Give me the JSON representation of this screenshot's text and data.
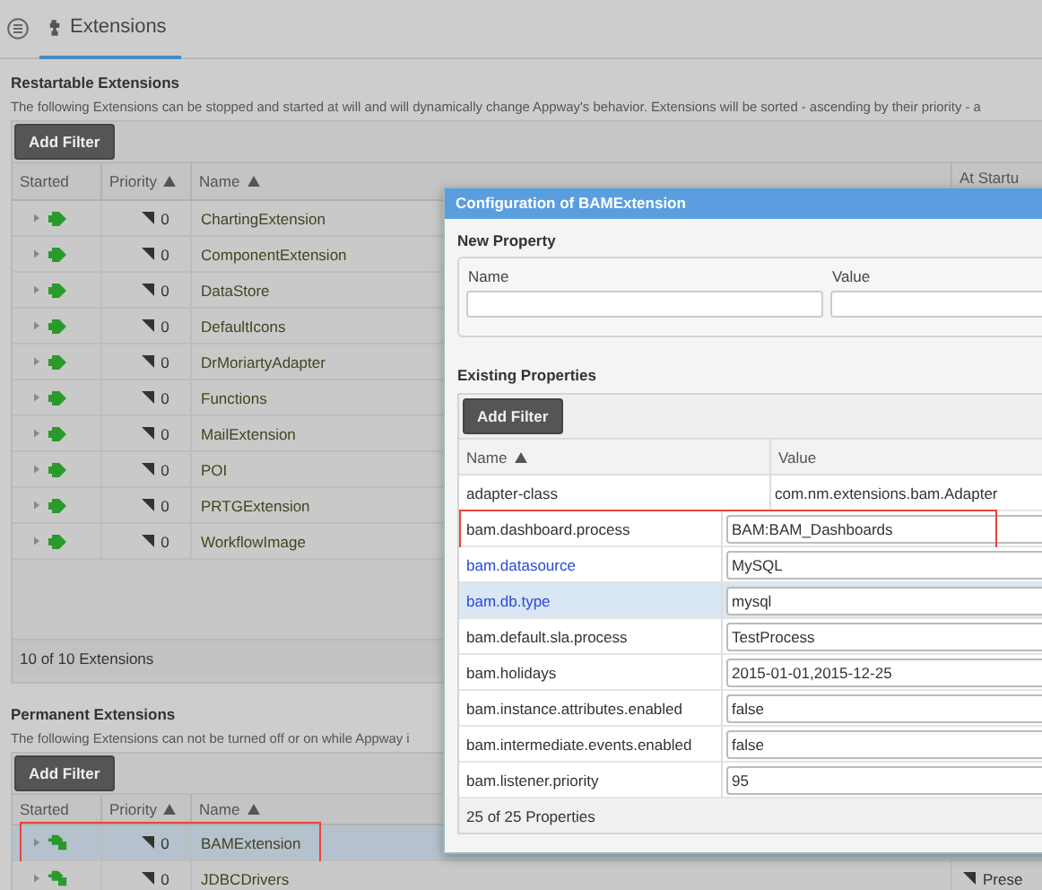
{
  "header": {
    "tab": {
      "label": "Extensions",
      "selected": true
    }
  },
  "restartable": {
    "title": "Restartable Extensions",
    "description": "The following Extensions can be stopped and started at will and will dynamically change Appway's behavior. Extensions will be sorted - ascending by their priority - a",
    "filter_button": "Add Filter",
    "columns": [
      {
        "label": "Started",
        "sorted": false
      },
      {
        "label": "Priority",
        "sorted": true
      },
      {
        "label": "Name",
        "sorted": true
      },
      {
        "label": "At Startu",
        "sorted": false
      }
    ],
    "rows": [
      {
        "priority": "0",
        "name": "ChartingExtension",
        "selected": false
      },
      {
        "priority": "0",
        "name": "ComponentExtension",
        "selected": false
      },
      {
        "priority": "0",
        "name": "DataStore",
        "selected": false
      },
      {
        "priority": "0",
        "name": "DefaultIcons",
        "selected": false
      },
      {
        "priority": "0",
        "name": "DrMoriartyAdapter",
        "selected": false
      },
      {
        "priority": "0",
        "name": "Functions",
        "selected": false
      },
      {
        "priority": "0",
        "name": "MailExtension",
        "selected": false
      },
      {
        "priority": "0",
        "name": "POI",
        "selected": false
      },
      {
        "priority": "0",
        "name": "PRTGExtension",
        "selected": false
      },
      {
        "priority": "0",
        "name": "WorkflowImage",
        "selected": false
      }
    ],
    "footer": "10 of 10 Extensions"
  },
  "permanent": {
    "title": "Permanent Extensions",
    "description": "The following Extensions can not be turned off or on while Appway i",
    "filter_button": "Add Filter",
    "columns": [
      {
        "label": "Started",
        "sorted": false
      },
      {
        "label": "Priority",
        "sorted": true
      },
      {
        "label": "Name",
        "sorted": true
      }
    ],
    "rows": [
      {
        "priority": "0",
        "name": "BAMExtension",
        "selected": true,
        "highlighted": true
      },
      {
        "priority": "0",
        "name": "JDBCDrivers",
        "selected": false,
        "highlighted": false,
        "column_4": "Prese"
      }
    ]
  },
  "dialog": {
    "title": "Configuration of BAMExtension",
    "new_property": {
      "title": "New Property",
      "name_label": "Name",
      "value_label": "Value"
    },
    "existing": {
      "title": "Existing Properties",
      "filter_button": "Add Filter",
      "columns": [
        {
          "label": "Name",
          "sorted": true
        },
        {
          "label": "Value",
          "sorted": false
        }
      ],
      "rows": [
        {
          "name": "adapter-class",
          "value": "com.nm.extensions.bam.Adapter",
          "kind": "text",
          "modified": false,
          "selected": false,
          "highlighted": false
        },
        {
          "name": "bam.dashboard.process",
          "value": "BAM:BAM_Dashboards",
          "kind": "input",
          "modified": false,
          "selected": false,
          "highlighted": true
        },
        {
          "name": "bam.datasource",
          "value": "MySQL",
          "kind": "input",
          "modified": true,
          "selected": false,
          "highlighted": false
        },
        {
          "name": "bam.db.type",
          "value": "mysql",
          "kind": "input",
          "modified": true,
          "selected": true,
          "highlighted": false
        },
        {
          "name": "bam.default.sla.process",
          "value": "TestProcess",
          "kind": "input",
          "modified": false,
          "selected": false,
          "highlighted": false
        },
        {
          "name": "bam.holidays",
          "value": "2015-01-01,2015-12-25",
          "kind": "input",
          "modified": false,
          "selected": false,
          "highlighted": false
        },
        {
          "name": "bam.instance.attributes.enabled",
          "value": "false",
          "kind": "input",
          "modified": false,
          "selected": false,
          "highlighted": false
        },
        {
          "name": "bam.intermediate.events.enabled",
          "value": "false",
          "kind": "input",
          "modified": false,
          "selected": false,
          "highlighted": false
        },
        {
          "name": "bam.listener.priority",
          "value": "95",
          "kind": "input",
          "modified": false,
          "selected": false,
          "highlighted": false
        }
      ],
      "footer": "25 of 25 Properties"
    }
  }
}
